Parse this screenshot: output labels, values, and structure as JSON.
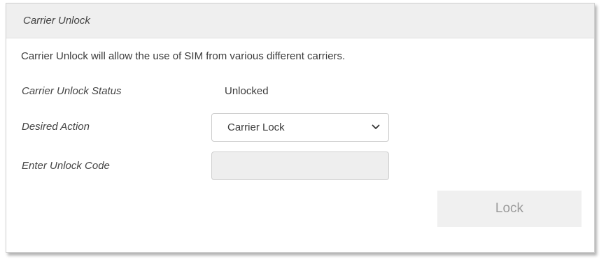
{
  "panel": {
    "title": "Carrier Unlock",
    "description": "Carrier Unlock will allow the use of SIM from various different carriers."
  },
  "status": {
    "label": "Carrier Unlock Status",
    "value": "Unlocked"
  },
  "desired_action": {
    "label": "Desired Action",
    "selected": "Carrier Lock",
    "icon": "chevron-down-icon"
  },
  "unlock_code": {
    "label": "Enter Unlock Code",
    "value": ""
  },
  "actions": {
    "submit_label": "Lock"
  },
  "colors": {
    "header_bg": "#efefef",
    "input_disabled_bg": "#eeeeee",
    "button_bg": "#f0f0f0",
    "button_text": "#9a9a9a"
  }
}
